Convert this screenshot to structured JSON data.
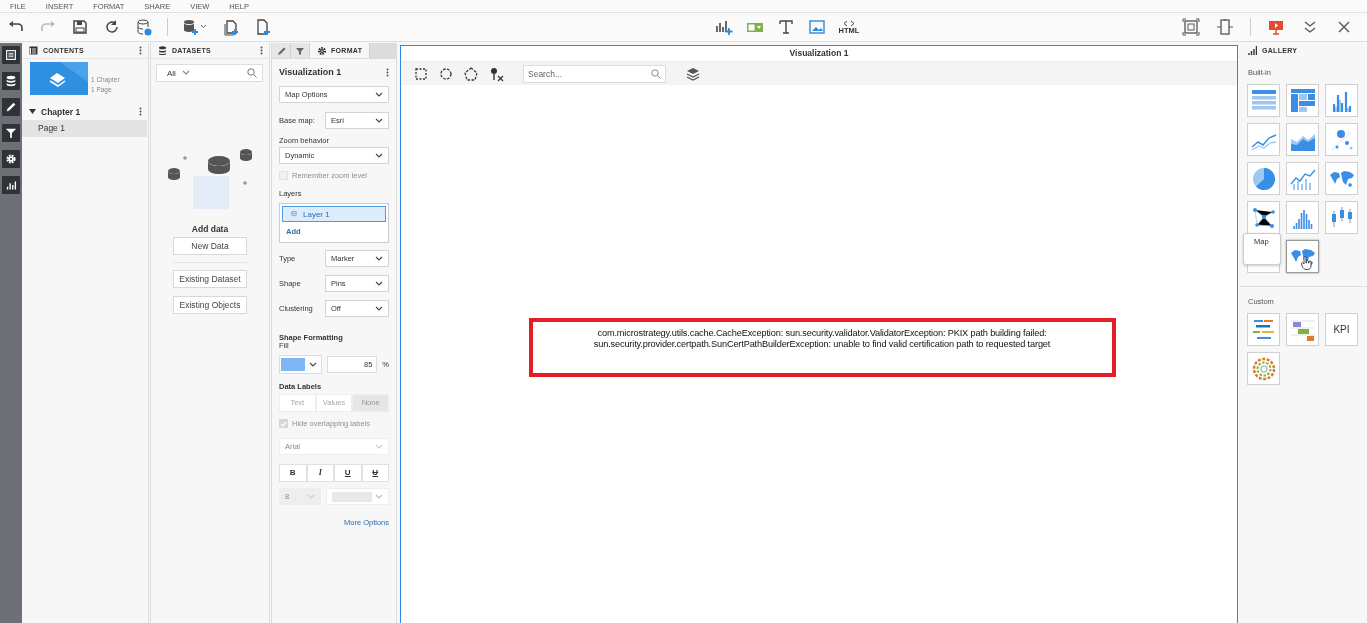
{
  "menu": [
    "FILE",
    "INSERT",
    "FORMAT",
    "SHARE",
    "VIEW",
    "HELP"
  ],
  "toolbar": {
    "left": [
      {
        "kind": "undo",
        "disabled": false
      },
      {
        "kind": "redo",
        "disabled": true
      },
      {
        "kind": "save",
        "disabled": false
      },
      {
        "kind": "refresh",
        "disabled": false
      },
      {
        "kind": "dataset-info",
        "disabled": false
      },
      {
        "kind": "divider"
      },
      {
        "kind": "add-data",
        "disabled": false
      },
      {
        "kind": "duplicate-page",
        "disabled": false
      },
      {
        "kind": "add-page",
        "disabled": false
      }
    ],
    "center": [
      {
        "kind": "insert-chart"
      },
      {
        "kind": "widget"
      },
      {
        "kind": "text"
      },
      {
        "kind": "image"
      },
      {
        "kind": "html",
        "label": "HTML"
      }
    ],
    "right": [
      {
        "kind": "fit"
      },
      {
        "kind": "panel"
      },
      {
        "kind": "divider"
      },
      {
        "kind": "present"
      },
      {
        "kind": "collapse"
      },
      {
        "kind": "close"
      }
    ]
  },
  "rail": [
    {
      "kind": "contents"
    },
    {
      "kind": "datasets"
    },
    {
      "kind": "edit"
    },
    {
      "kind": "filter"
    },
    {
      "kind": "settings"
    },
    {
      "kind": "gallery"
    }
  ],
  "contents": {
    "title": "CONTENTS",
    "summary": [
      "1 Chapter",
      "1 Page"
    ],
    "chapters": [
      {
        "title": "Chapter 1",
        "expanded": true,
        "children": [
          {
            "title": "Page 1",
            "selected": true
          }
        ]
      }
    ]
  },
  "datasets": {
    "title": "DATASETS",
    "filter": "All",
    "empty_title": "Add data",
    "buttons": [
      "New Data",
      "Existing Dataset",
      "Existing Objects"
    ]
  },
  "format": {
    "tabs": [
      {
        "kind": "edit",
        "selected": false
      },
      {
        "kind": "filter",
        "selected": false
      },
      {
        "kind": "format",
        "label": "FORMAT",
        "selected": true
      }
    ],
    "title": "Visualization 1",
    "controls": [
      {
        "kind": "dropdown",
        "value": "Map Options",
        "disabled": false
      },
      {
        "kind": "labeled-dropdown",
        "label": "Base map:",
        "value": "Esri",
        "disabled": false
      },
      {
        "kind": "label",
        "text": "Zoom behavior"
      },
      {
        "kind": "dropdown",
        "value": "Dynamic",
        "disabled": false
      },
      {
        "kind": "checkbox",
        "label": "Remember zoom level",
        "checked": false,
        "disabled": true
      },
      {
        "kind": "label",
        "text": "Layers"
      },
      {
        "kind": "layers",
        "items": [
          {
            "label": "Layer 1",
            "selected": true
          }
        ],
        "action": "Add"
      },
      {
        "kind": "labeled-dropdown",
        "label": "Type",
        "value": "Marker",
        "disabled": false
      },
      {
        "kind": "labeled-dropdown",
        "label": "Shape",
        "value": "Pins",
        "disabled": false
      },
      {
        "kind": "labeled-dropdown",
        "label": "Clustering",
        "value": "Off",
        "disabled": false
      },
      {
        "kind": "heading",
        "text": "Shape Formatting"
      },
      {
        "kind": "label",
        "text": "Fill"
      },
      {
        "kind": "fill",
        "color": "#7fb6f5",
        "value": "85",
        "unit": "%"
      },
      {
        "kind": "heading",
        "text": "Data Labels"
      },
      {
        "kind": "segmented",
        "options": [
          {
            "label": "Text",
            "selected": false
          },
          {
            "label": "Values",
            "selected": false
          },
          {
            "label": "None",
            "selected": true
          }
        ]
      },
      {
        "kind": "checkbox",
        "label": "Hide overlapping labels",
        "checked": true,
        "disabled": true
      },
      {
        "kind": "dropdown",
        "value": "Arial",
        "disabled": true
      },
      {
        "kind": "font-styles",
        "options": [
          {
            "kind": "bold",
            "label": "B"
          },
          {
            "kind": "italic",
            "label": "I"
          },
          {
            "kind": "underline",
            "label": "U"
          },
          {
            "kind": "strikethrough",
            "label": "U"
          }
        ]
      },
      {
        "kind": "size-color",
        "size": "8",
        "disabled": true
      },
      {
        "kind": "link",
        "text": "More Options"
      }
    ]
  },
  "canvas": {
    "title": "Visualization 1",
    "tools": [
      {
        "kind": "marquee"
      },
      {
        "kind": "lasso"
      },
      {
        "kind": "polygon"
      },
      {
        "kind": "clear-pins"
      }
    ],
    "search": {
      "placeholder": "Search..."
    },
    "tools_after": [
      {
        "kind": "layers"
      }
    ],
    "error": {
      "lines": [
        "com.microstrategy.utils.cache.CacheException: sun.security.validator.ValidatorException: PKIX path building failed:",
        "sun.security.provider.certpath.SunCertPathBuilderException: unable to find valid certification path to requested target"
      ]
    }
  },
  "gallery": {
    "title": "GALLERY",
    "sections": [
      {
        "title": "Built-in",
        "tiles": [
          {
            "kind": "grid",
            "hovered": false
          },
          {
            "kind": "heatmap",
            "hovered": false
          },
          {
            "kind": "bars",
            "hovered": false
          },
          {
            "kind": "line",
            "hovered": false
          },
          {
            "kind": "area",
            "hovered": false
          },
          {
            "kind": "bubble",
            "hovered": false
          },
          {
            "kind": "pie",
            "hovered": false
          },
          {
            "kind": "combo",
            "hovered": false
          },
          {
            "kind": "map",
            "hovered": false
          },
          {
            "kind": "network",
            "hovered": false
          },
          {
            "kind": "histogram",
            "hovered": false
          },
          {
            "kind": "boxplot",
            "hovered": false
          },
          {
            "kind": "tile",
            "hovered": false
          },
          {
            "kind": "map",
            "hovered": true,
            "tooltip": "Map"
          }
        ]
      },
      {
        "title": "Custom",
        "tiles": [
          {
            "kind": "datacloud",
            "hovered": false
          },
          {
            "kind": "gantt",
            "hovered": false
          },
          {
            "kind": "kpi",
            "label": "KPI",
            "hovered": false
          },
          {
            "kind": "ring",
            "hovered": false
          }
        ]
      }
    ]
  }
}
